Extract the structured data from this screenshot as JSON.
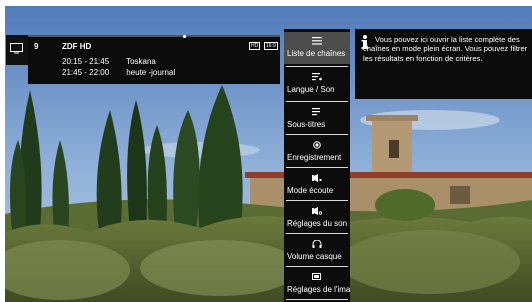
{
  "channel": {
    "number": "9",
    "name": "ZDF HD",
    "badges": [
      "HD",
      "16:9"
    ],
    "progress_fraction": 0.62
  },
  "programmes": [
    {
      "time": "20:15 - 21:45",
      "title": "Toskana"
    },
    {
      "time": "21:45 - 22:00",
      "title": "heute -journal"
    }
  ],
  "menu": {
    "items": [
      {
        "label": "Liste de chaînes",
        "icon": "list-icon",
        "selected": true
      },
      {
        "label": "Langue / Son",
        "icon": "audio-language-icon",
        "selected": false
      },
      {
        "label": "Sous-titres",
        "icon": "subtitles-icon",
        "selected": false
      },
      {
        "label": "Enregistrement",
        "icon": "record-icon",
        "selected": false
      },
      {
        "label": "Mode écoute",
        "icon": "sound-mode-icon",
        "selected": false
      },
      {
        "label": "Réglages du son",
        "icon": "sound-settings-icon",
        "selected": false
      },
      {
        "label": "Volume casque",
        "icon": "headphone-icon",
        "selected": false
      },
      {
        "label": "Réglages de l'image",
        "icon": "picture-settings-icon",
        "selected": false
      }
    ]
  },
  "tooltip": {
    "icon": "info-icon",
    "text": "Vous pouvez ici ouvrir la liste complète des chaînes en mode plein écran. Vous pouvez filtrer les résultats en fonction de critères."
  },
  "colors": {
    "panel": "#0b0b0b",
    "menu_selected": "#4d4d4d",
    "text": "#ffffff"
  }
}
